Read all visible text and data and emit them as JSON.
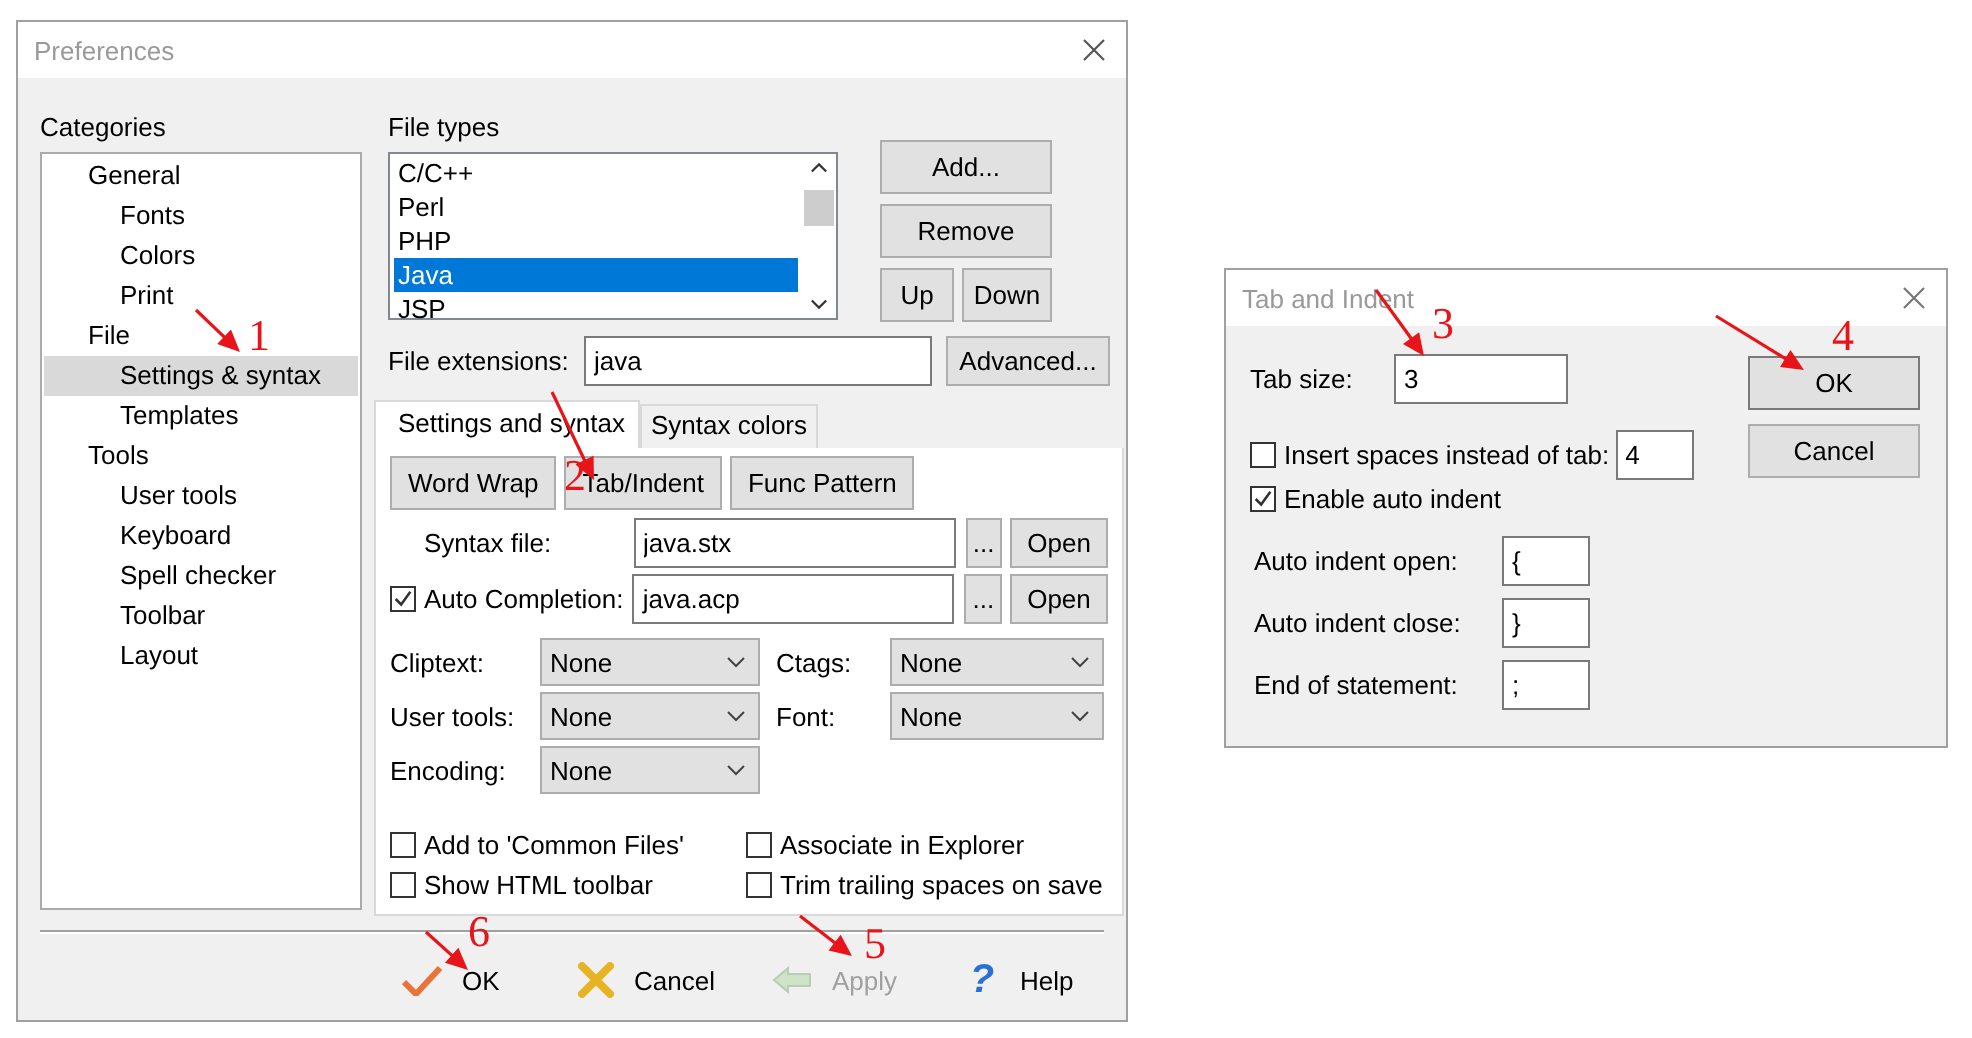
{
  "preferences": {
    "title": "Preferences",
    "categories_label": "Categories",
    "categories": [
      {
        "label": "General",
        "selected": false,
        "children": [
          {
            "label": "Fonts",
            "selected": false
          },
          {
            "label": "Colors",
            "selected": false
          },
          {
            "label": "Print",
            "selected": false
          }
        ]
      },
      {
        "label": "File",
        "selected": false,
        "children": [
          {
            "label": "Settings & syntax",
            "selected": true
          },
          {
            "label": "Templates",
            "selected": false
          }
        ]
      },
      {
        "label": "Tools",
        "selected": false,
        "children": [
          {
            "label": "User tools",
            "selected": false
          },
          {
            "label": "Keyboard",
            "selected": false
          },
          {
            "label": "Spell checker",
            "selected": false
          },
          {
            "label": "Toolbar",
            "selected": false
          },
          {
            "label": "Layout",
            "selected": false
          }
        ]
      }
    ],
    "file_types_label": "File types",
    "file_types": [
      {
        "label": "C/C++",
        "selected": false
      },
      {
        "label": "Perl",
        "selected": false
      },
      {
        "label": "PHP",
        "selected": false
      },
      {
        "label": "Java",
        "selected": true
      },
      {
        "label": "JSP",
        "selected": false
      }
    ],
    "file_type_buttons": [
      "Add...",
      "Remove",
      "Up",
      "Down"
    ],
    "file_extensions": {
      "label": "File extensions:",
      "value": "java"
    },
    "advanced_button": "Advanced...",
    "tabs": [
      {
        "label": "Settings and syntax",
        "selected": true
      },
      {
        "label": "Syntax colors",
        "selected": false
      }
    ],
    "panel_buttons": [
      "Word Wrap",
      "Tab/Indent",
      "Func Pattern"
    ],
    "file_rows": [
      {
        "kind": "plain",
        "label": "Syntax file:",
        "value": "java.stx",
        "browse": "...",
        "open": "Open"
      },
      {
        "kind": "checkbox",
        "checked": true,
        "label": "Auto Completion:",
        "value": "java.acp",
        "browse": "...",
        "open": "Open"
      }
    ],
    "dropdowns": [
      {
        "label": "Cliptext:",
        "value": "None"
      },
      {
        "label": "Ctags:",
        "value": "None"
      },
      {
        "label": "User tools:",
        "value": "None"
      },
      {
        "label": "Font:",
        "value": "None"
      },
      {
        "label": "Encoding:",
        "value": "None"
      }
    ],
    "options": [
      {
        "label": "Add to 'Common Files'",
        "checked": false
      },
      {
        "label": "Associate in Explorer",
        "checked": false
      },
      {
        "label": "Show HTML toolbar",
        "checked": false
      },
      {
        "label": "Trim trailing spaces on save",
        "checked": false
      }
    ],
    "footer_buttons": [
      {
        "kind": "ok",
        "label": "OK",
        "disabled": false
      },
      {
        "kind": "cancel",
        "label": "Cancel",
        "disabled": false
      },
      {
        "kind": "apply",
        "label": "Apply",
        "disabled": true
      },
      {
        "kind": "help",
        "label": "Help",
        "icon": "?",
        "disabled": false
      }
    ]
  },
  "tab_indent": {
    "title": "Tab and Indent",
    "tab_size": {
      "label": "Tab size:",
      "value": "3"
    },
    "insert_spaces": {
      "label": "Insert spaces instead of tab:",
      "checked": false,
      "value": "4"
    },
    "auto_indent": {
      "label": "Enable auto indent",
      "checked": true
    },
    "fields": [
      {
        "label": "Auto indent open:",
        "value": "{"
      },
      {
        "label": "Auto indent close:",
        "value": "}"
      },
      {
        "label": "End of statement:",
        "value": ";"
      }
    ],
    "buttons": [
      "OK",
      "Cancel"
    ]
  },
  "annotations": [
    {
      "number": "1"
    },
    {
      "number": "2"
    },
    {
      "number": "3"
    },
    {
      "number": "4"
    },
    {
      "number": "5"
    },
    {
      "number": "6"
    }
  ]
}
